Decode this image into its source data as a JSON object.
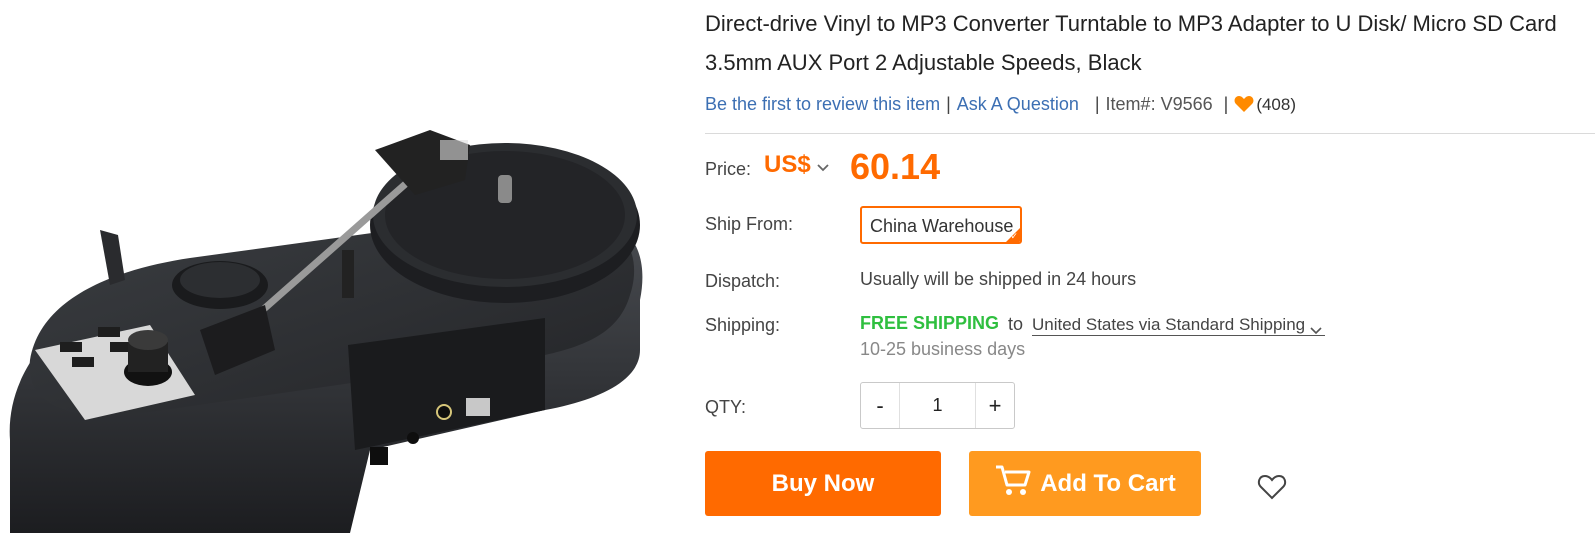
{
  "product": {
    "title": "Direct-drive Vinyl to MP3 Converter Turntable to MP3 Adapter to U Disk/ Micro SD Card 3.5mm AUX Port 2 Adjustable Speeds, Black",
    "review_link": "Be the first to review this item",
    "ask_link": "Ask A Question",
    "item_number": "Item#: V9566",
    "favorites_count": "(408)"
  },
  "price": {
    "label": "Price:",
    "currency": "US$",
    "value": "60.14"
  },
  "ship_from": {
    "label": "Ship From:",
    "selected": "China Warehouse"
  },
  "dispatch": {
    "label": "Dispatch:",
    "text": "Usually will be shipped in 24 hours"
  },
  "shipping": {
    "label": "Shipping:",
    "free": "FREE SHIPPING",
    "to": "to",
    "destination": "United States via Standard Shipping",
    "days": "10-25 business days"
  },
  "quantity": {
    "label": "QTY:",
    "minus": "-",
    "value": "1",
    "plus": "+"
  },
  "actions": {
    "buy_now": "Buy Now",
    "add_to_cart": "Add To Cart"
  },
  "colors": {
    "accent": "#ff6a00",
    "cart": "#ff9a1f",
    "free_shipping": "#2fbf3f",
    "link": "#3c6fb3"
  },
  "icons": [
    "heart-icon",
    "chevron-down-icon",
    "cart-icon",
    "wishlist-heart-icon",
    "check-icon"
  ]
}
